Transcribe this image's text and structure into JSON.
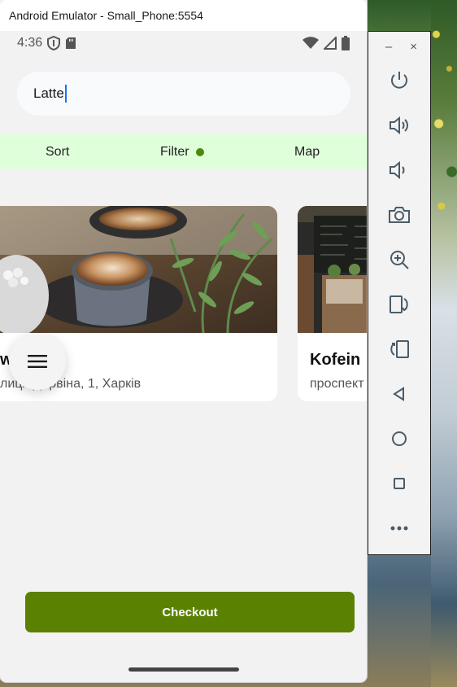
{
  "window": {
    "title": "Android Emulator - Small_Phone:5554"
  },
  "status_bar": {
    "time": "4:36"
  },
  "search": {
    "value": "Latte"
  },
  "toolbar": {
    "sort_label": "Sort",
    "filter_label": "Filter",
    "map_label": "Map"
  },
  "cards": [
    {
      "title": "w",
      "address": "лиця Дарвіна, 1, Харків"
    },
    {
      "title": "Kofein",
      "address": "проспект"
    }
  ],
  "checkout": {
    "label": "Checkout"
  },
  "side_panel": {
    "minimize_label": "–",
    "close_label": "×",
    "buttons": [
      "power-icon",
      "volume-up-icon",
      "volume-down-icon",
      "camera-icon",
      "zoom-icon",
      "rotate-left-icon",
      "rotate-right-icon",
      "back-icon",
      "home-icon",
      "overview-icon",
      "more-icon"
    ]
  },
  "colors": {
    "accent_green": "#5a8102",
    "toolbar_bg": "#dfffdb",
    "filter_dot": "#4e8a08"
  }
}
